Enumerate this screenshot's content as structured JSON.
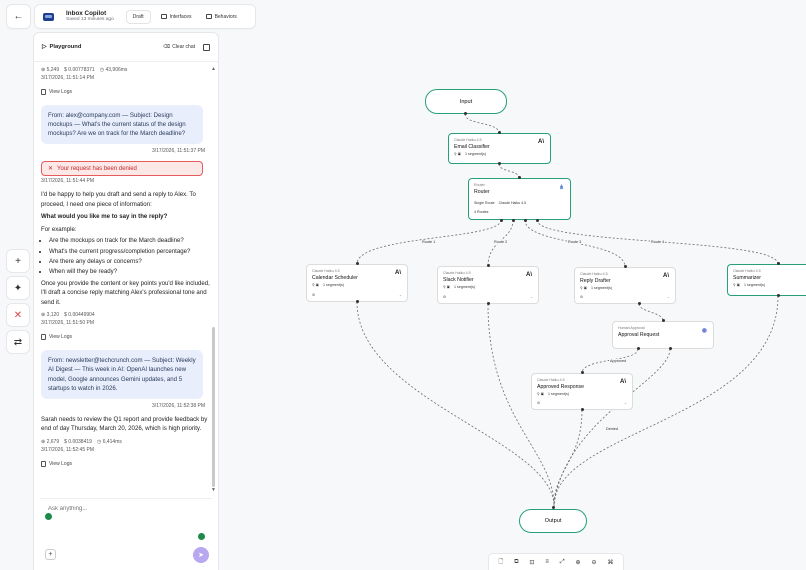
{
  "header": {
    "back_label": "←",
    "app_title": "Inbox Copilot",
    "saved": "Saved 13 minutes ago",
    "draft": "Draft",
    "tabs": [
      {
        "label": "Interfaces",
        "icon": "monitor-icon"
      },
      {
        "label": "Behaviors",
        "icon": "chat-icon"
      }
    ]
  },
  "side_tools": [
    {
      "icon": "plus-icon",
      "glyph": "+"
    },
    {
      "icon": "magic-wand-icon",
      "glyph": "✦"
    },
    {
      "icon": "close-icon",
      "glyph": "✕"
    },
    {
      "icon": "branch-icon",
      "glyph": "⇄"
    }
  ],
  "playground": {
    "title": "Playground",
    "clear_label": "Clear chat",
    "messages": [
      {
        "type": "meta",
        "tokens": "5,249",
        "cost": "$ 0.00778371",
        "time": "43,906ms",
        "ts": "3/17/2026, 11:51:14 PM",
        "logs": "View Logs"
      },
      {
        "type": "user",
        "text": "From: alex@company.com — Subject: Design mockups — What's the current status of the design mockups? Are we on track for the March deadline?",
        "ts": "3/17/2026, 11:51:37 PM"
      },
      {
        "type": "error",
        "text": "Your request has been denied",
        "ts": "3/17/2026, 11:51:44 PM"
      },
      {
        "type": "bot",
        "intro": "I'd be happy to help you draft and send a reply to Alex. To proceed, I need one piece of information:",
        "question": "What would you like me to say in the reply?",
        "example_lead": "For example:",
        "bullets": [
          "Are the mockups on track for the March deadline?",
          "What's the current progress/completion percentage?",
          "Are there any delays or concerns?",
          "When will they be ready?"
        ],
        "outro": "Once you provide the content or key points you'd like included, I'll draft a concise reply matching Alex's professional tone and send it.",
        "tokens": "3,120",
        "cost": "$ 0.00449904",
        "ts": "3/17/2026, 11:51:50 PM",
        "logs": "View Logs"
      },
      {
        "type": "user",
        "text": "From: newsletter@techcrunch.com — Subject: Weekly AI Digest — This week in AI: OpenAI launches new model, Google announces Gemini updates, and 5 startups to watch in 2026.",
        "ts": "3/17/2026, 11:52:38 PM"
      },
      {
        "type": "bot2",
        "text": "Sarah needs to review the Q1 report and provide feedback by end of day Thursday, March 20, 2026, which is high priority.",
        "tokens": "2,679",
        "cost": "$ 0.0038419",
        "time": "6,414ms",
        "ts": "3/17/2026, 11:52:45 PM",
        "logs": "View Logs"
      }
    ],
    "composer_placeholder": "Ask anything..."
  },
  "workflow": {
    "nodes": {
      "input": "Input",
      "output": "Output",
      "email_classifier": {
        "sub": "Claude Haiku 4.5",
        "title": "Email Classifier",
        "meta": "1 segment(s)"
      },
      "router": {
        "sub": "Router",
        "title": "Router",
        "meta1": "Single Route",
        "meta2": "Claude Haiku 4.5",
        "meta3": "4 Routes"
      },
      "calendar": {
        "sub": "Claude Haiku 4.5",
        "title": "Calendar Scheduler",
        "meta": "1 segment(s)"
      },
      "slack": {
        "sub": "Claude Haiku 4.5",
        "title": "Slack Notifier",
        "meta": "1 segment(s)"
      },
      "reply": {
        "sub": "Claude Haiku 4.5",
        "title": "Reply Drafter",
        "meta": "1 segment(s)"
      },
      "summarizer": {
        "sub": "Claude Haiku 4.5",
        "title": "Summarizer",
        "meta": "1 segment(s)"
      },
      "approval": {
        "sub": "Human Approval",
        "title": "Approval Request"
      },
      "approved": {
        "sub": "Claude Haiku 4.5",
        "title": "Approved Response",
        "meta": "1 segment(s)"
      }
    },
    "edge_labels": {
      "route1": "Route 1",
      "route2": "Route 2",
      "route3": "Route 3",
      "route4": "Route 4",
      "approved": "Approved",
      "denied": "Denied"
    }
  }
}
